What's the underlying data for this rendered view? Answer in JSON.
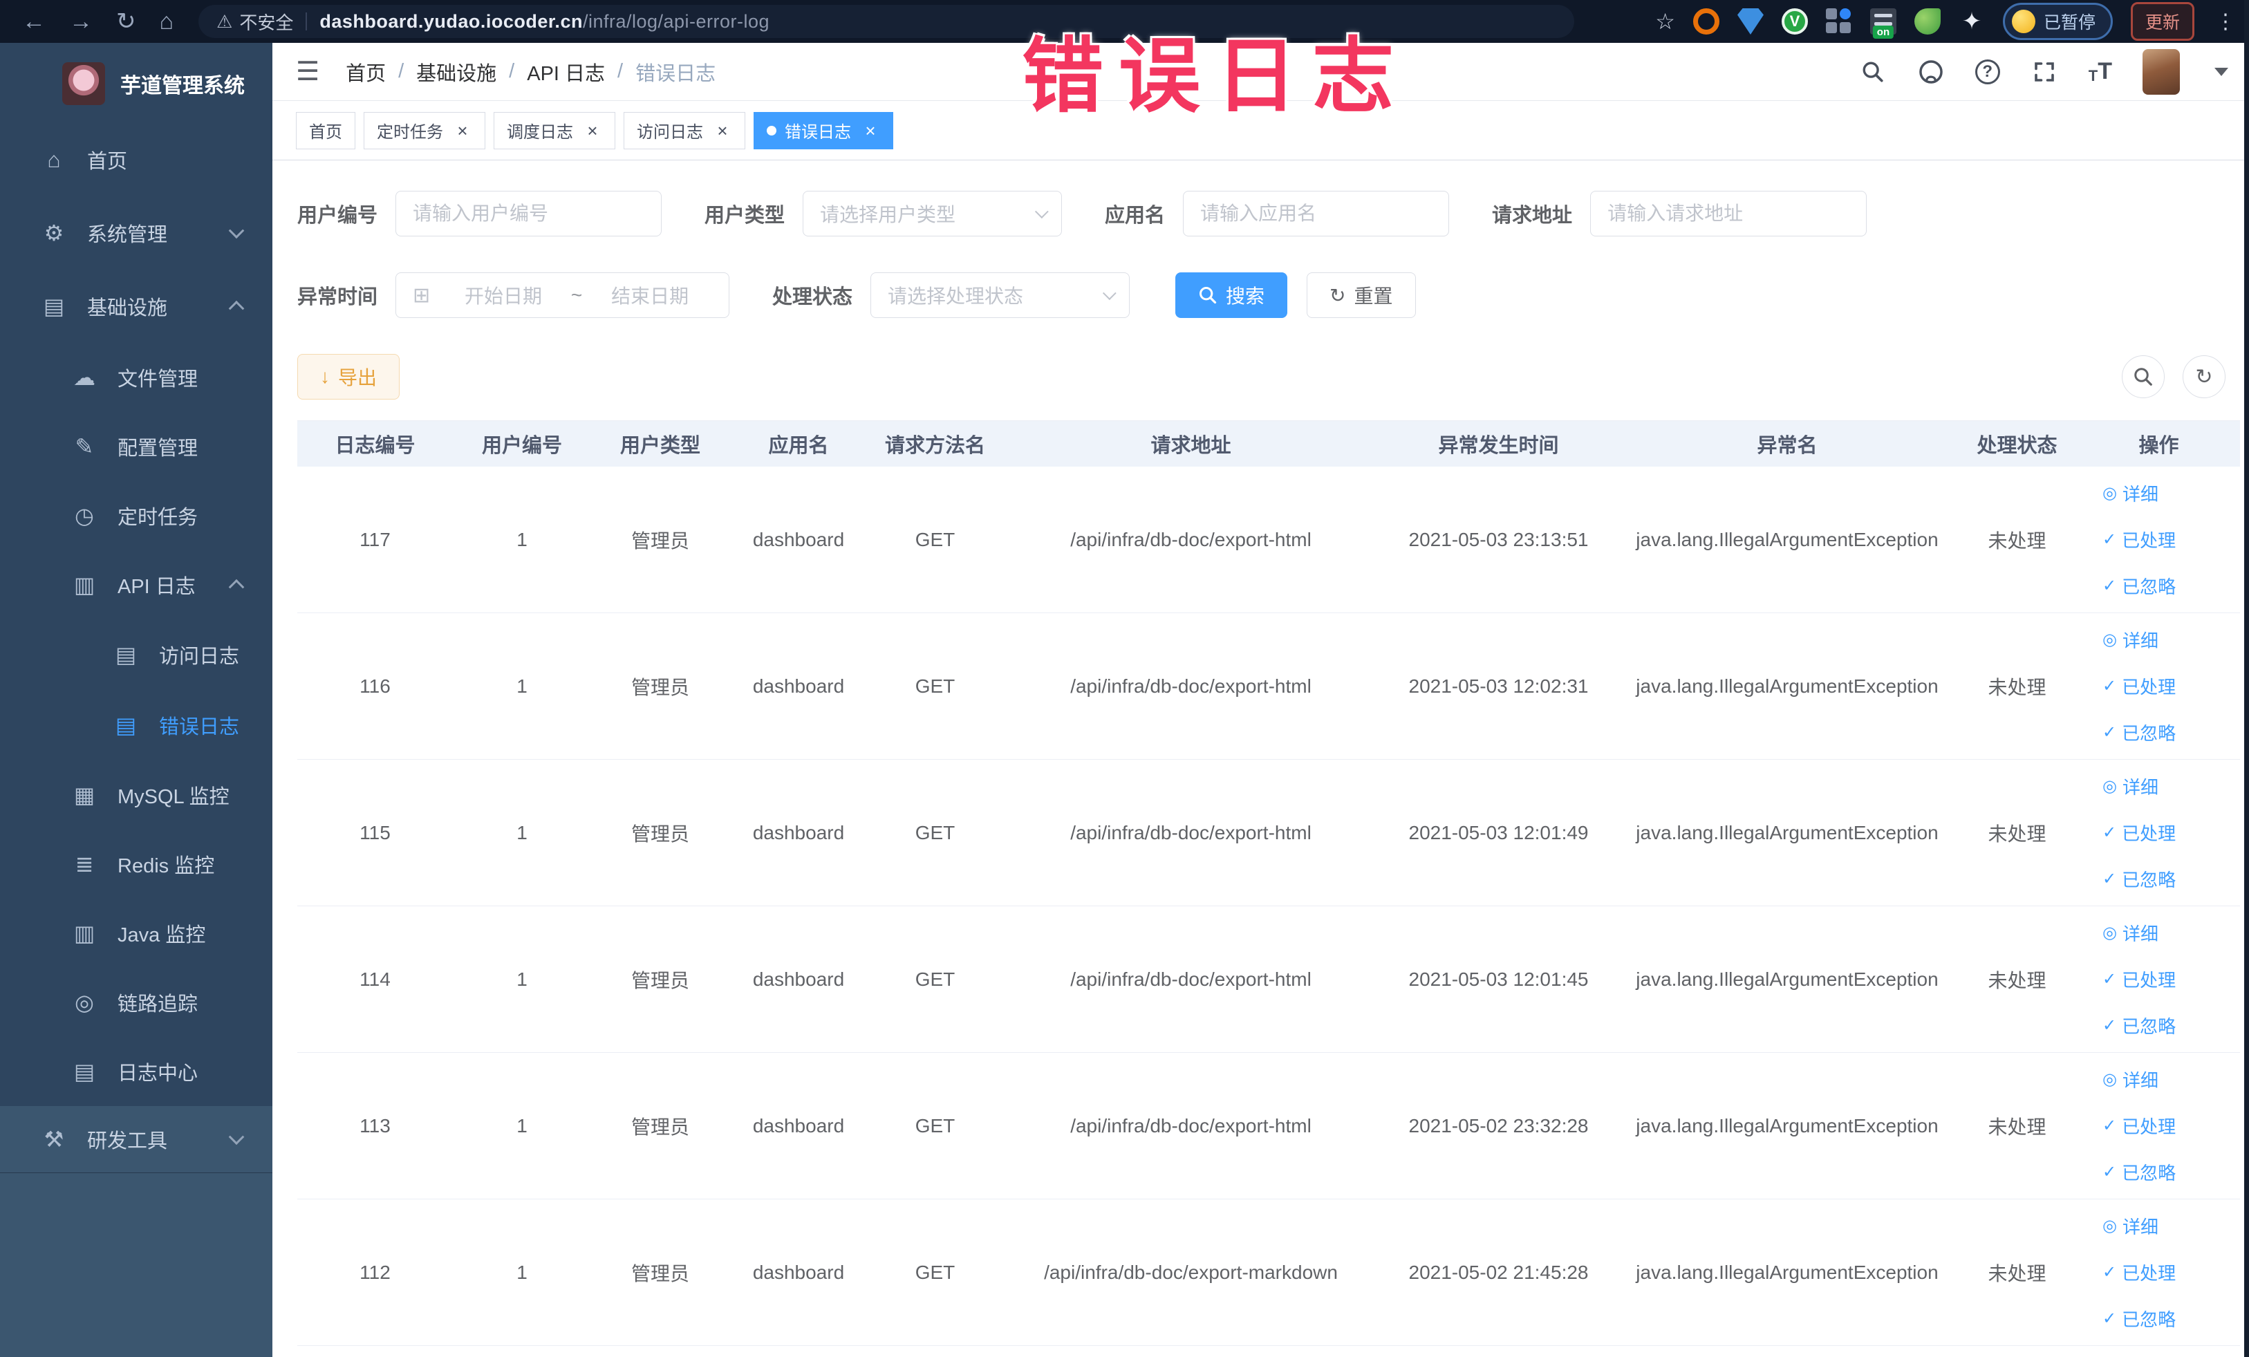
{
  "browser": {
    "security_label": "不安全",
    "url_domain": "dashboard.yudao.iocoder.cn",
    "url_path": "/infra/log/api-error-log",
    "on_badge": "on",
    "paused_badge": "已暂停",
    "update_label": "更新"
  },
  "annotation": {
    "text": "错误日志"
  },
  "sidebar": {
    "title": "芋道管理系统",
    "items": [
      {
        "label": "首页",
        "icon": "⌂",
        "name": "home",
        "depth": 0
      },
      {
        "label": "系统管理",
        "icon": "⚙",
        "name": "system-management",
        "depth": 0,
        "chevron": "down"
      },
      {
        "label": "基础设施",
        "icon": "▤",
        "name": "infrastructure",
        "depth": 0,
        "chevron": "up"
      },
      {
        "label": "文件管理",
        "icon": "☁",
        "name": "file-management",
        "depth": 1
      },
      {
        "label": "配置管理",
        "icon": "✎",
        "name": "config-management",
        "depth": 1
      },
      {
        "label": "定时任务",
        "icon": "◷",
        "name": "scheduled-tasks",
        "depth": 1
      },
      {
        "label": "API 日志",
        "icon": "▥",
        "name": "api-log",
        "depth": 1,
        "chevron": "up"
      },
      {
        "label": "访问日志",
        "icon": "▤",
        "name": "access-log",
        "depth": 2
      },
      {
        "label": "错误日志",
        "icon": "▤",
        "name": "error-log",
        "depth": 2,
        "active": true
      },
      {
        "label": "MySQL 监控",
        "icon": "▦",
        "name": "mysql-monitor",
        "depth": 1
      },
      {
        "label": "Redis 监控",
        "icon": "≣",
        "name": "redis-monitor",
        "depth": 1
      },
      {
        "label": "Java 监控",
        "icon": "▥",
        "name": "java-monitor",
        "depth": 1
      },
      {
        "label": "链路追踪",
        "icon": "◎",
        "name": "trace",
        "depth": 1
      },
      {
        "label": "日志中心",
        "icon": "▤",
        "name": "log-center",
        "depth": 1
      },
      {
        "label": "研发工具",
        "icon": "⚒",
        "name": "dev-tools",
        "depth": 0,
        "chevron": "down",
        "light": true
      }
    ]
  },
  "header": {
    "breadcrumb": {
      "items": [
        "首页",
        "基础设施",
        "API 日志",
        "错误日志"
      ],
      "separator": "/"
    }
  },
  "tags": {
    "close_glyph": "×",
    "items": [
      {
        "label": "首页"
      },
      {
        "label": "定时任务",
        "closable": true
      },
      {
        "label": "调度日志",
        "closable": true
      },
      {
        "label": "访问日志",
        "closable": true
      },
      {
        "label": "错误日志",
        "closable": true,
        "active": true
      }
    ]
  },
  "filters": {
    "user_id": {
      "label": "用户编号",
      "placeholder": "请输入用户编号"
    },
    "user_type": {
      "label": "用户类型",
      "placeholder": "请选择用户类型"
    },
    "app_name": {
      "label": "应用名",
      "placeholder": "请输入应用名"
    },
    "request_url": {
      "label": "请求地址",
      "placeholder": "请输入请求地址"
    },
    "exception_time": {
      "label": "异常时间",
      "start_placeholder": "开始日期",
      "separator": "~",
      "end_placeholder": "结束日期",
      "calendar_glyph": "⊞"
    },
    "process_status": {
      "label": "处理状态",
      "placeholder": "请选择处理状态"
    },
    "search_label": "搜索",
    "reset_label": "重置",
    "reset_glyph": "↻"
  },
  "toolbar": {
    "export_label": "导出",
    "download_glyph": "↓",
    "refresh_glyph": "↻"
  },
  "table": {
    "columns": [
      "日志编号",
      "用户编号",
      "用户类型",
      "应用名",
      "请求方法名",
      "请求地址",
      "异常发生时间",
      "异常名",
      "处理状态",
      "操作"
    ],
    "rows": [
      [
        "117",
        "1",
        "管理员",
        "dashboard",
        "GET",
        "/api/infra/db-doc/export-html",
        "2021-05-03 23:13:51",
        "java.lang.IllegalArgumentException",
        "未处理"
      ],
      [
        "116",
        "1",
        "管理员",
        "dashboard",
        "GET",
        "/api/infra/db-doc/export-html",
        "2021-05-03 12:02:31",
        "java.lang.IllegalArgumentException",
        "未处理"
      ],
      [
        "115",
        "1",
        "管理员",
        "dashboard",
        "GET",
        "/api/infra/db-doc/export-html",
        "2021-05-03 12:01:49",
        "java.lang.IllegalArgumentException",
        "未处理"
      ],
      [
        "114",
        "1",
        "管理员",
        "dashboard",
        "GET",
        "/api/infra/db-doc/export-html",
        "2021-05-03 12:01:45",
        "java.lang.IllegalArgumentException",
        "未处理"
      ],
      [
        "113",
        "1",
        "管理员",
        "dashboard",
        "GET",
        "/api/infra/db-doc/export-html",
        "2021-05-02 23:32:28",
        "java.lang.IllegalArgumentException",
        "未处理"
      ],
      [
        "112",
        "1",
        "管理员",
        "dashboard",
        "GET",
        "/api/infra/db-doc/export-markdown",
        "2021-05-02 21:45:28",
        "java.lang.IllegalArgumentException",
        "未处理"
      ]
    ],
    "row_actions": [
      {
        "label": "详细",
        "icon": "◎"
      },
      {
        "label": "已处理",
        "icon": "✓"
      },
      {
        "label": "已忽略",
        "icon": "✓"
      }
    ]
  }
}
